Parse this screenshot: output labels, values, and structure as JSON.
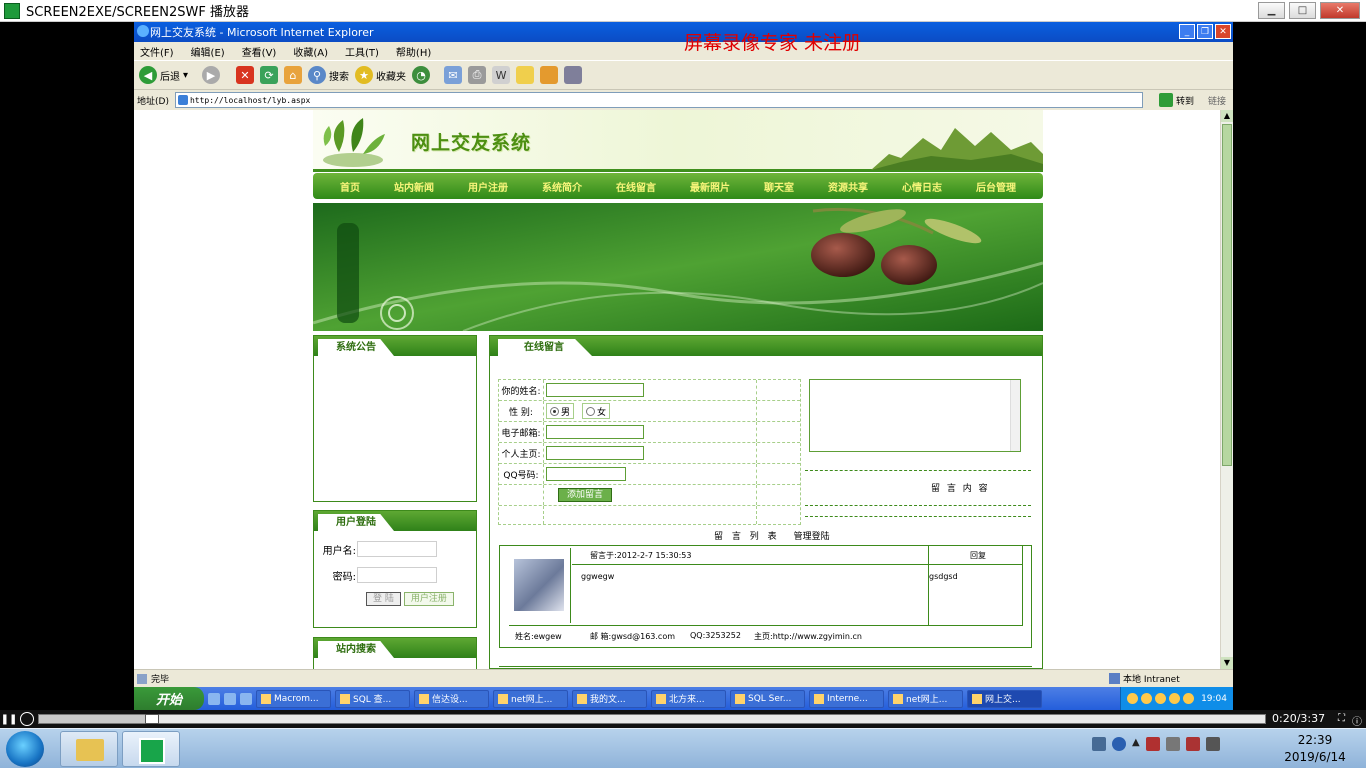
{
  "player": {
    "title": "SCREEN2EXE/SCREEN2SWF 播放器",
    "time": "0:20/3:37",
    "progress": 0.092
  },
  "ie": {
    "title": "网上交友系统 - Microsoft Internet Explorer",
    "watermark": "屏幕录像专家  未注册",
    "menu": [
      "文件(F)",
      "编辑(E)",
      "查看(V)",
      "收藏(A)",
      "工具(T)",
      "帮助(H)"
    ],
    "toolbar": {
      "back": "后退",
      "search": "搜索",
      "favorites": "收藏夹"
    },
    "address_label": "地址(D)",
    "address": "http://localhost/lyb.aspx",
    "go": "转到",
    "links": "链接",
    "status": "完毕",
    "zone": "本地 Intranet"
  },
  "xp_taskbar": {
    "start": "开始",
    "tasks": [
      "Macrom...",
      "SQL 查...",
      "信达设...",
      "net网上...",
      "我的文...",
      "北方来...",
      "SQL Ser...",
      "Interne...",
      "net网上...",
      "网上交..."
    ],
    "clock": "19:04"
  },
  "site": {
    "title": "网上交友系统",
    "nav": [
      "首页",
      "站内新闻",
      "用户注册",
      "系统简介",
      "在线留言",
      "最新照片",
      "聊天室",
      "资源共享",
      "心情日志",
      "后台管理"
    ],
    "announcement_title": "系统公告",
    "login": {
      "title": "用户登陆",
      "username_label": "用户名:",
      "password_label": "密码:",
      "login_btn": "登 陆",
      "register_btn": "用户注册"
    },
    "search_title": "站内搜索",
    "guestbook": {
      "title": "在线留言",
      "name_label": "你的姓名:",
      "gender_label": "性 别:",
      "male": "男",
      "female": "女",
      "email_label": "电子邮箱:",
      "homepage_label": "个人主页:",
      "qq_label": "QQ号码:",
      "submit": "添加留言",
      "content_label": "留 言 内 容",
      "list_title": "留 言 列 表",
      "admin_login": "管理登陆"
    },
    "entry": {
      "posted": "留言于:2012-2-7 15:30:53",
      "reply_label": "回复",
      "content": "ggwegw",
      "reply": "gsdgsd",
      "name": "姓名:ewgew",
      "email": "邮 箱:gwsd@163.com",
      "qq": "QQ:3253252",
      "homepage": "主页:http://www.zgyimin.cn"
    }
  },
  "win7": {
    "time": "22:39",
    "date": "2019/6/14"
  }
}
